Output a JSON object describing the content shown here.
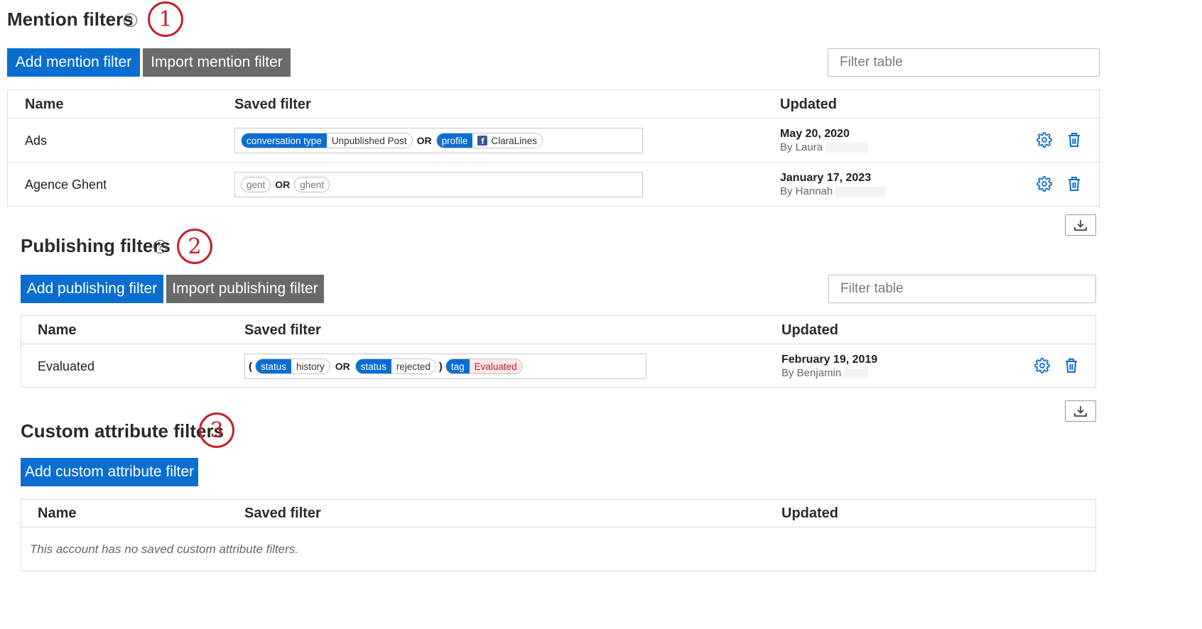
{
  "mention": {
    "title": "Mention filters",
    "step": "1",
    "add_label": "Add mention filter",
    "import_label": "Import mention filter",
    "filter_placeholder": "Filter table",
    "columns": {
      "name": "Name",
      "saved": "Saved filter",
      "updated": "Updated"
    },
    "rows": [
      {
        "name": "Ads",
        "chip1_key": "conversation type",
        "chip1_val": "Unpublished Post",
        "op": "OR",
        "chip2_key": "profile",
        "chip2_val": "ClaraLines",
        "date": "May 20, 2020",
        "by": "By Laura"
      },
      {
        "name": "Agence Ghent",
        "chip1_val": "gent",
        "op": "OR",
        "chip2_val": "ghent",
        "date": "January 17, 2023",
        "by": "By Hannah"
      }
    ]
  },
  "publishing": {
    "title": "Publishing filters",
    "step": "2",
    "add_label": "Add publishing filter",
    "import_label": "Import publishing filter",
    "filter_placeholder": "Filter table",
    "columns": {
      "name": "Name",
      "saved": "Saved filter",
      "updated": "Updated"
    },
    "rows": [
      {
        "name": "Evaluated",
        "open_paren": "(",
        "close_paren": ")",
        "chip1_key": "status",
        "chip1_val": "history",
        "op": "OR",
        "chip2_key": "status",
        "chip2_val": "rejected",
        "chip3_key": "tag",
        "chip3_val": "Evaluated",
        "date": "February 19, 2019",
        "by": "By Benjamin"
      }
    ]
  },
  "custom": {
    "title": "Custom attribute filters",
    "step": "3",
    "add_label": "Add custom attribute filter",
    "columns": {
      "name": "Name",
      "saved": "Saved filter",
      "updated": "Updated"
    },
    "empty_text": "This account has no saved custom attribute filters."
  },
  "help_glyph": "?",
  "colors": {
    "primary": "#0a6ed1",
    "secondary": "#6a6a6a",
    "annotation": "#c4202b"
  },
  "icons": [
    "help-circle-icon",
    "gear-icon",
    "trash-icon",
    "download-icon",
    "facebook-icon"
  ]
}
